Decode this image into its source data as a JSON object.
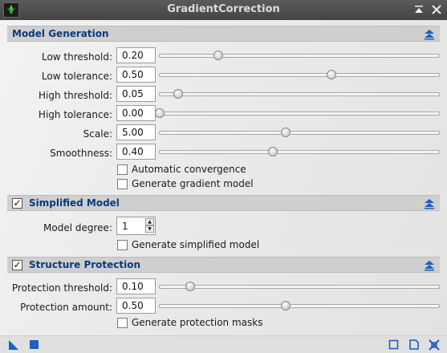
{
  "window": {
    "title": "GradientCorrection"
  },
  "titlebar": {
    "shade_icon": "shade-icon",
    "close_icon": "close-icon"
  },
  "model_generation": {
    "header": "Model Generation",
    "rows": [
      {
        "label": "Low threshold:",
        "value": "0.20",
        "fraction": 0.21
      },
      {
        "label": "Low tolerance:",
        "value": "0.50",
        "fraction": 0.615
      },
      {
        "label": "High threshold:",
        "value": "0.05",
        "fraction": 0.065
      },
      {
        "label": "High tolerance:",
        "value": "0.00",
        "fraction": 0.0
      },
      {
        "label": "Scale:",
        "value": "5.00",
        "fraction": 0.45
      },
      {
        "label": "Smoothness:",
        "value": "0.40",
        "fraction": 0.405
      }
    ],
    "automatic_convergence": "Automatic convergence",
    "generate_gradient_model": "Generate gradient model"
  },
  "simplified_model": {
    "header": "Simplified Model",
    "enabled": true,
    "model_degree_label": "Model degree:",
    "model_degree_value": "1",
    "generate_simplified_model": "Generate simplified model"
  },
  "structure_protection": {
    "header": "Structure Protection",
    "enabled": true,
    "rows": [
      {
        "label": "Protection threshold:",
        "value": "0.10",
        "fraction": 0.11
      },
      {
        "label": "Protection amount:",
        "value": "0.50",
        "fraction": 0.45
      }
    ],
    "generate_protection_masks": "Generate protection masks"
  },
  "colors": {
    "section_header_text": "#0a3a7c",
    "accent": "#1f5fbf"
  }
}
